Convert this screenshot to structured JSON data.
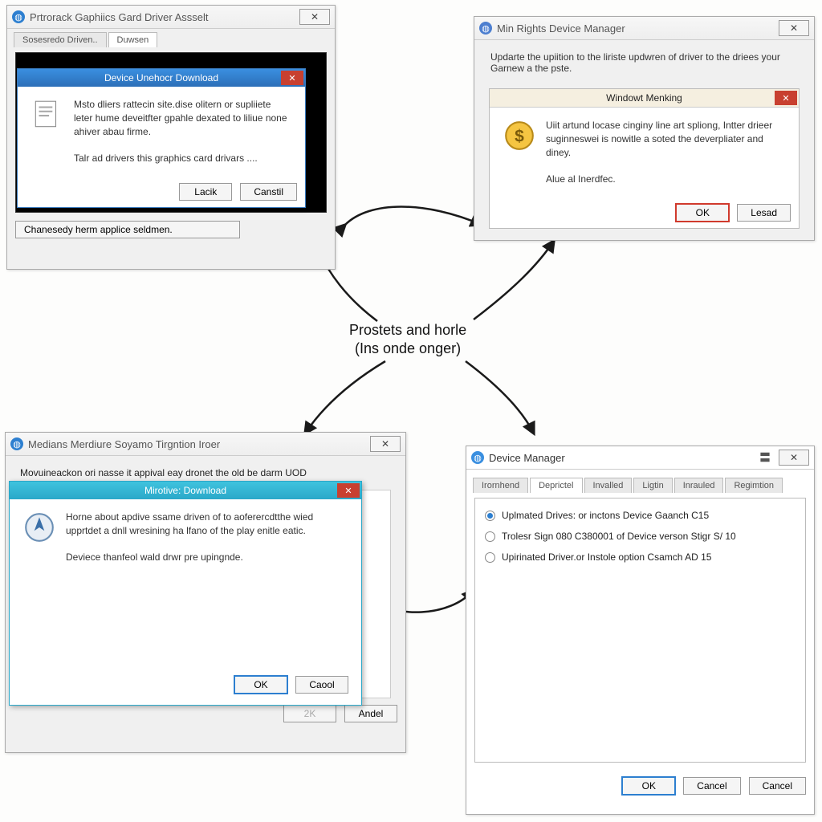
{
  "center": {
    "line1": "Prostets and horle",
    "line2": "(Ins onde onger)"
  },
  "tl": {
    "title": "Prtrorack Gaphiics Gard Driver Assselt",
    "tabs": [
      "Sosesredo Driven..",
      "Duwsen"
    ],
    "active_tab": 1,
    "bottom_btn": "Chanesedy herm applice seldmen.",
    "modal": {
      "title": "Device Unehocr Download",
      "body1": "Msto dliers rattecin site.dise olitern or supliiete leter hume deveitfter gpahle dexated to liliue none ahiver abau firme.",
      "body2": "Talr ad drivers this graphics card drivars ....",
      "btn1": "Lacik",
      "btn2": "Canstil"
    }
  },
  "tr": {
    "title": "Min Rights Device Manager",
    "intro": "Updarte the upiition to the liriste updwren of driver to the driees your Garnew a the pste.",
    "modal": {
      "title": "Windowt Menking",
      "body1": "Uiit artund locase cinginy line art spliong, Intter drieer suginneswei is nowitle a soted the deverpliater and diney.",
      "body2": "Alue al Inerdfec.",
      "btn1": "OK",
      "btn2": "Lesad"
    }
  },
  "bl": {
    "title": "Medians Merdiure Soyamo Tirgntion Iroer",
    "intro": "Movuineackon ori nasse it appival eay dronet the old be darm UOD",
    "btn_ok": "2K",
    "btn_cancel": "Andel",
    "modal": {
      "title": "Mirotive: Download",
      "body1": "Horne about apdive ssame driven of to aoferercdtthe wied upprtdet a dnll wresining ha lfano of the play enitle eatic.",
      "body2": "Deviece thanfeol wald drwr pre upingnde.",
      "btn1": "OK",
      "btn2": "Caool"
    }
  },
  "br": {
    "title": "Device Manager",
    "tabs": [
      "Irornhend",
      "Deprictel",
      "Invalled",
      "Ligtin",
      "Inrauled",
      "Regimtion"
    ],
    "active_tab": 1,
    "options": [
      "Uplmated Drives: or inctons Device Gaanch C15",
      "Trolesr Sign 080 C380001 of Device verson Stigr S/ 10",
      "Upirinated Driver.or Instole option Csamch AD 15"
    ],
    "selected": 0,
    "btn_ok": "OK",
    "btn_c1": "Cancel",
    "btn_c2": "Cancel"
  }
}
